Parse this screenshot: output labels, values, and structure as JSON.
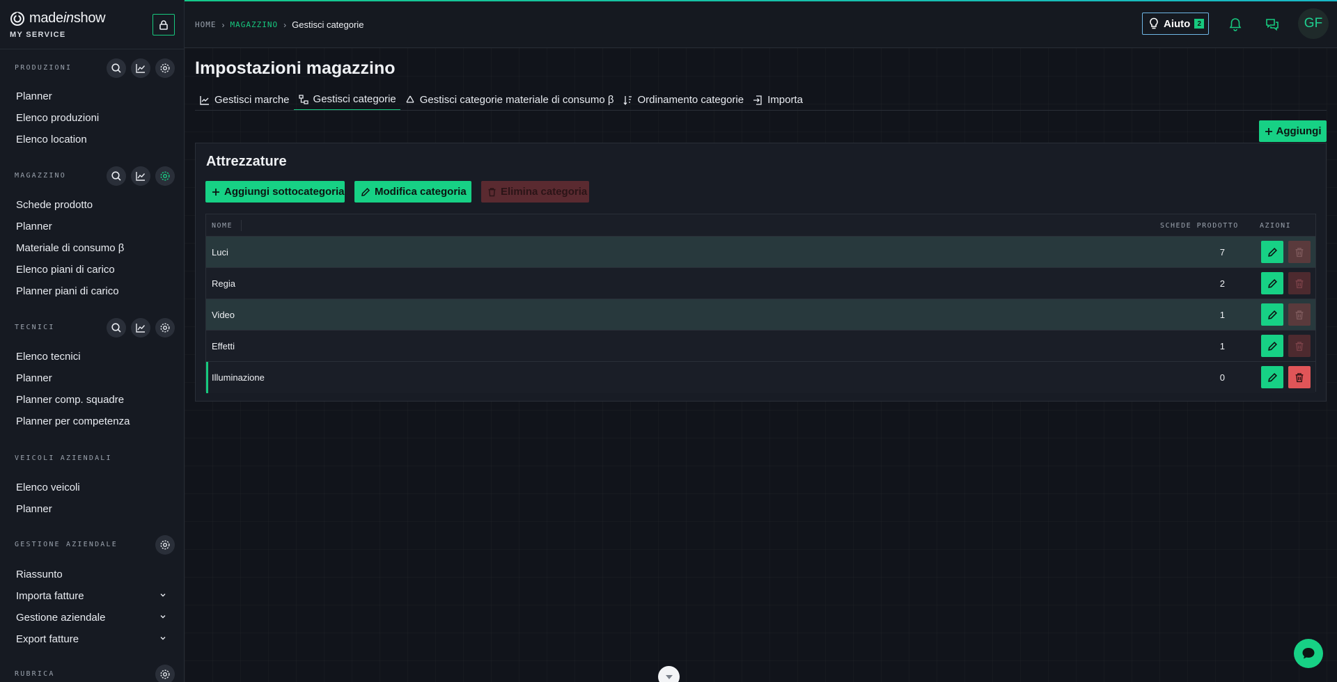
{
  "brand": {
    "name_prefix": "made",
    "name_italic": "in",
    "name_suffix": "show",
    "subtitle": "MY SERVICE"
  },
  "sidebar": {
    "sections": [
      {
        "title": "PRODUZIONI",
        "items": [
          "Planner",
          "Elenco produzioni",
          "Elenco location"
        ]
      },
      {
        "title": "MAGAZZINO",
        "items": [
          "Schede prodotto",
          "Planner",
          "Materiale di consumo β",
          "Elenco piani di carico",
          "Planner piani di carico"
        ]
      },
      {
        "title": "TECNICI",
        "items": [
          "Elenco tecnici",
          "Planner",
          "Planner comp. squadre",
          "Planner per competenza"
        ]
      },
      {
        "title": "VEICOLI AZIENDALI",
        "items": [
          "Elenco veicoli",
          "Planner"
        ]
      },
      {
        "title": "GESTIONE AZIENDALE",
        "items": [
          "Riassunto",
          "Importa fatture",
          "Gestione aziendale",
          "Export fatture"
        ]
      },
      {
        "title": "RUBRICA",
        "items": []
      }
    ]
  },
  "breadcrumb": {
    "home": "HOME",
    "section": "MAGAZZINO",
    "current": "Gestisci categorie"
  },
  "header": {
    "help_label": "Aiuto",
    "help_badge": "2",
    "avatar_initials": "GF"
  },
  "page": {
    "title": "Impostazioni magazzino",
    "tabs": [
      "Gestisci marche",
      "Gestisci categorie",
      "Gestisci categorie materiale di consumo β",
      "Ordinamento categorie",
      "Importa"
    ],
    "active_tab": "Gestisci categorie",
    "add_label": "Aggiungi"
  },
  "category": {
    "title": "Attrezzature",
    "add_sub_label": "Aggiungi sottocategoria",
    "edit_label": "Modifica categoria",
    "delete_label": "Elimina categoria"
  },
  "table": {
    "headers": {
      "name": "NOME",
      "count": "SCHEDE PRODOTTO",
      "actions": "AZIONI"
    },
    "rows": [
      {
        "name": "Luci",
        "count": "7"
      },
      {
        "name": "Regia",
        "count": "2"
      },
      {
        "name": "Video",
        "count": "1"
      },
      {
        "name": "Effetti",
        "count": "1"
      },
      {
        "name": "Illuminazione",
        "count": "0"
      }
    ]
  },
  "colors": {
    "accent": "#17d185",
    "danger": "#e05558",
    "danger_muted": "#5a2a30",
    "background": "#11141b",
    "help_border": "#6fb7e6"
  }
}
